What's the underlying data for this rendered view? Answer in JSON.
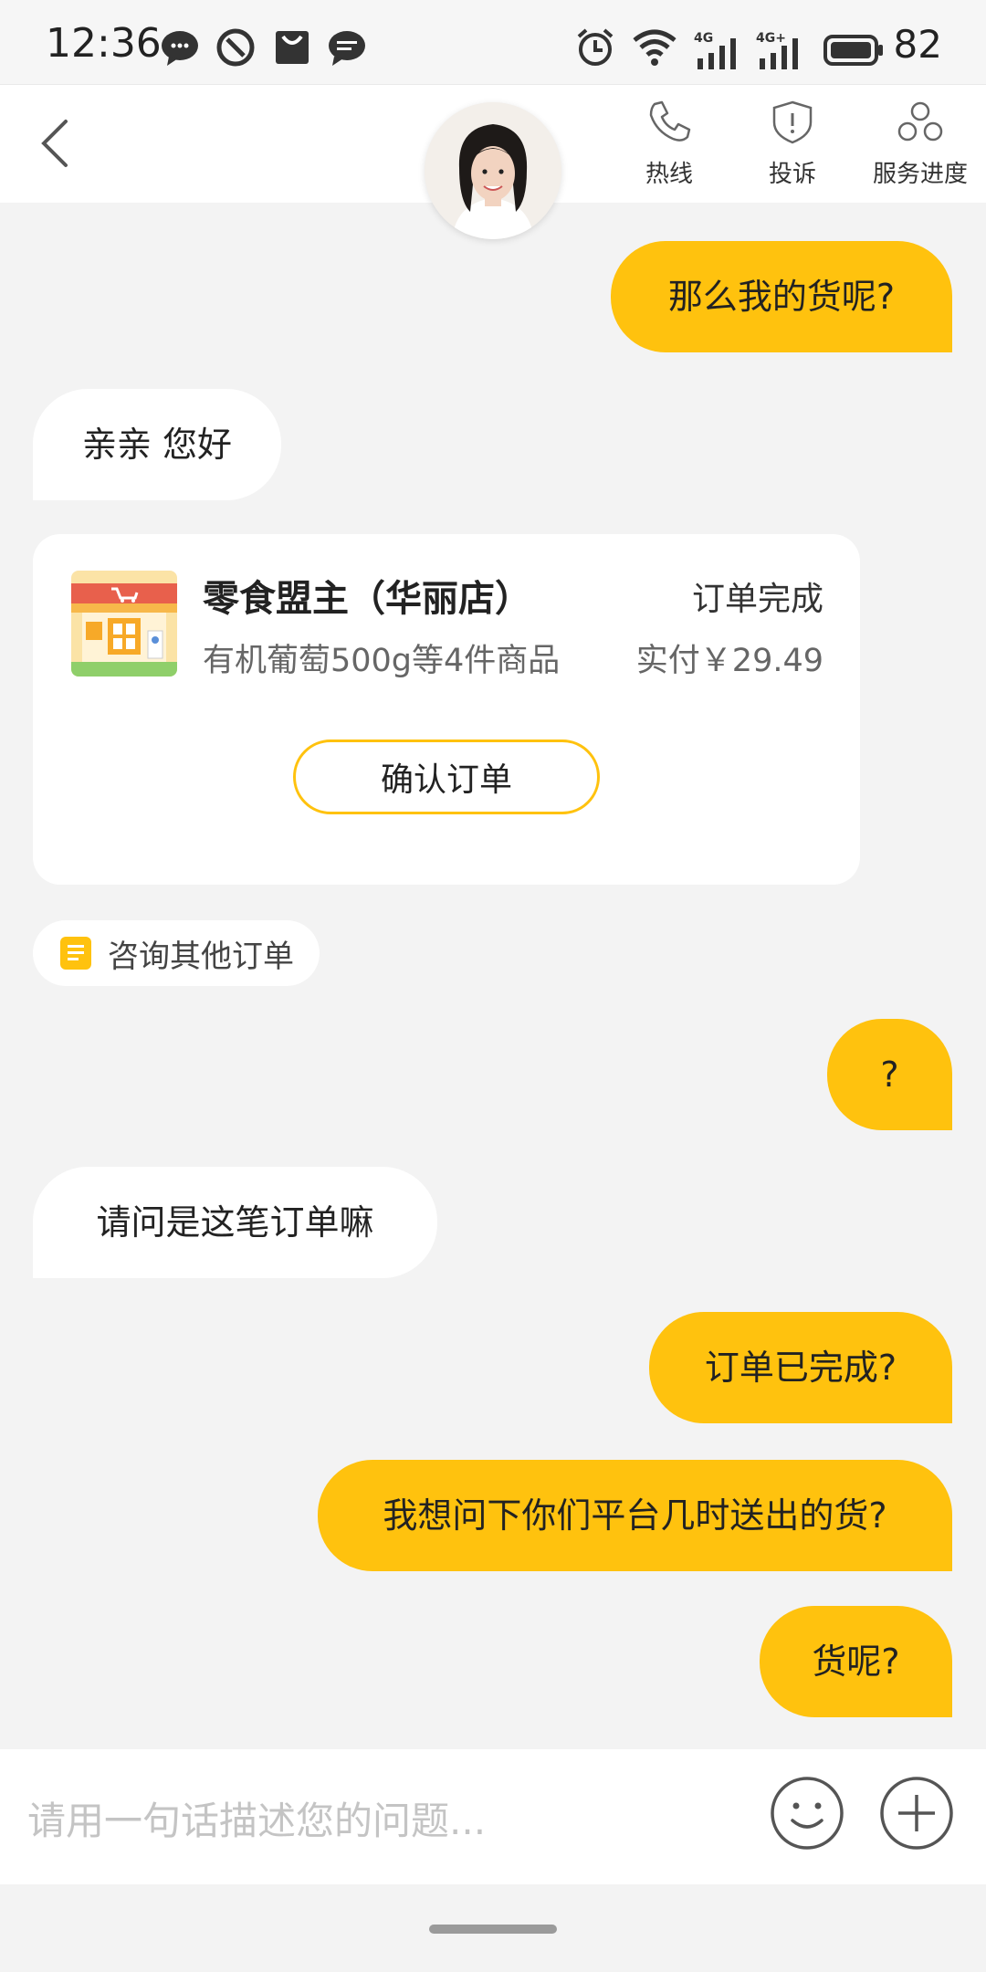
{
  "status_bar": {
    "time": "12:36",
    "battery": "82",
    "net1": "4G",
    "net2": "4G+"
  },
  "header": {
    "buttons": [
      {
        "label": "热线",
        "icon": "phone-icon"
      },
      {
        "label": "投诉",
        "icon": "shield-alert-icon"
      },
      {
        "label": "服务进度",
        "icon": "progress-icon"
      }
    ]
  },
  "messages": [
    {
      "from": "me",
      "text": "那么我的货呢?"
    },
    {
      "from": "agent",
      "text": "亲亲 您好"
    },
    {
      "from": "me",
      "text": "?"
    },
    {
      "from": "agent",
      "text": "请问是这笔订单嘛"
    },
    {
      "from": "me",
      "text": "订单已完成?"
    },
    {
      "from": "me",
      "text": "我想问下你们平台几时送出的货?"
    },
    {
      "from": "me",
      "text": "货呢?"
    }
  ],
  "order_card": {
    "shop_name": "零食盟主（华丽店）",
    "status": "订单完成",
    "goods": "有机葡萄500g等4件商品",
    "paid": "实付￥29.49",
    "confirm_label": "确认订单"
  },
  "consult_other": "咨询其他订单",
  "input": {
    "placeholder": "请用一句话描述您的问题..."
  },
  "colors": {
    "accent": "#ffc20e",
    "background": "#f3f3f3"
  }
}
